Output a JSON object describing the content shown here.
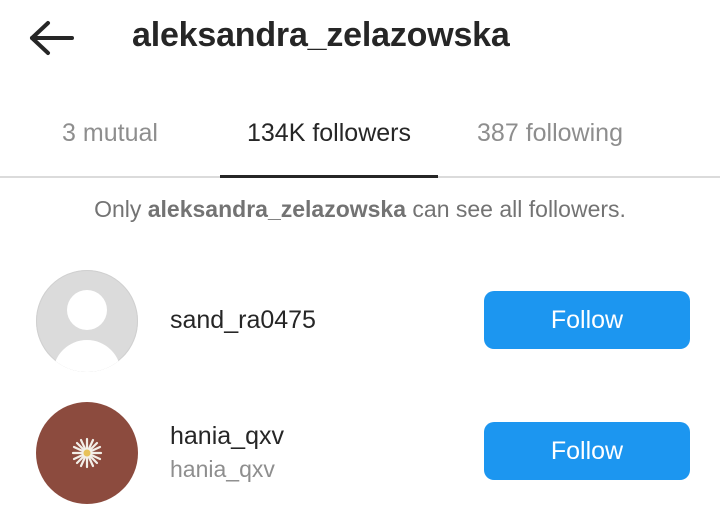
{
  "header": {
    "back_icon": "arrow-left-icon",
    "title": "aleksandra_zelazowska"
  },
  "tabs": [
    {
      "label": "3 mutual",
      "active": false
    },
    {
      "label": "134K followers",
      "active": true
    },
    {
      "label": "387 following",
      "active": false
    }
  ],
  "notice": {
    "prefix": "Only ",
    "username": "aleksandra_zelazowska",
    "suffix": " can see all followers."
  },
  "followers": [
    {
      "username": "sand_ra0475",
      "subtitle": "",
      "avatar": "default-avatar-icon",
      "button_label": "Follow"
    },
    {
      "username": "hania_qxv",
      "subtitle": "hania_qxv",
      "avatar": "flower-photo-avatar",
      "button_label": "Follow"
    }
  ],
  "colors": {
    "accent": "#1c96f0",
    "text_primary": "#262626",
    "text_secondary": "#8e8e8e",
    "divider": "#dbdbdb"
  }
}
